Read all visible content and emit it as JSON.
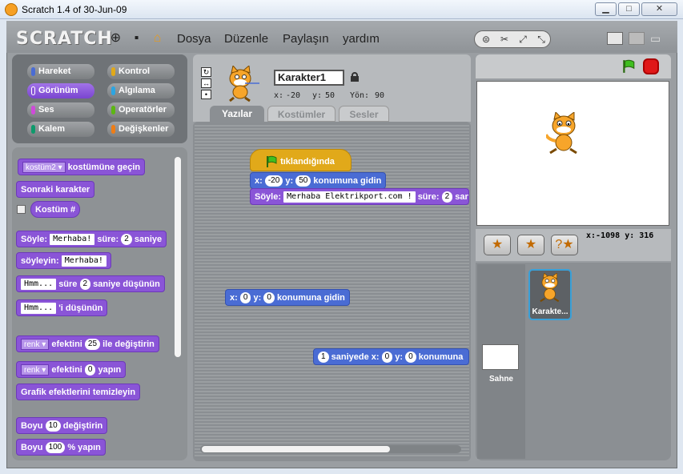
{
  "window": {
    "title": "Scratch 1.4 of 30-Jun-09",
    "minimize": "▁",
    "maximize": "□",
    "close": "✕"
  },
  "menubar": {
    "logo": "SCRATCH",
    "menus": [
      "Dosya",
      "Düzenle",
      "Paylaşın",
      "yardım"
    ]
  },
  "categories": [
    {
      "label": "Hareket",
      "color": "#4a6cd4"
    },
    {
      "label": "Kontrol",
      "color": "#e1a91a"
    },
    {
      "label": "Görünüm",
      "color": "#8a55d7",
      "selected": true
    },
    {
      "label": "Algılama",
      "color": "#2ca5e2"
    },
    {
      "label": "Ses",
      "color": "#cf4ad9"
    },
    {
      "label": "Operatörler",
      "color": "#5cb712"
    },
    {
      "label": "Kalem",
      "color": "#0e9a6c"
    },
    {
      "label": "Değişkenler",
      "color": "#ee7d16"
    }
  ],
  "palette": {
    "switch_costume": {
      "dropdown": "kostüm2",
      "text": "kostümüne geçin"
    },
    "next_costume": "Sonraki karakter",
    "costume_num": "Kostüm #",
    "say_for": {
      "pre": "Söyle:",
      "arg": "Merhaba!",
      "mid": "süre:",
      "num": "2",
      "post": "saniye"
    },
    "say": {
      "pre": "söyleyin:",
      "arg": "Merhaba!"
    },
    "think_for": {
      "arg": "Hmm...",
      "mid": "süre",
      "num": "2",
      "post": "saniye düşünün"
    },
    "think": {
      "arg": "Hmm...",
      "post": "'i düşünün"
    },
    "change_effect": {
      "dropdown": "renk",
      "mid": "efektini",
      "num": "25",
      "post": "ile değiştirin"
    },
    "set_effect": {
      "dropdown": "renk",
      "mid": "efektini",
      "num": "0",
      "post": "yapın"
    },
    "clear_effects": "Grafik efektlerini temizleyin",
    "change_size": {
      "pre": "Boyu",
      "num": "10",
      "post": "değiştirin"
    },
    "set_size": {
      "pre": "Boyu",
      "num": "100",
      "post": "% yapın"
    }
  },
  "sprite": {
    "name": "Karakter1",
    "x_label": "x:",
    "x": "-20",
    "y_label": "y:",
    "y": "50",
    "dir_label": "Yön:",
    "dir": "90"
  },
  "tabs": [
    "Yazılar",
    "Kostümler",
    "Sesler"
  ],
  "scripts": {
    "hat": "tıklandığında",
    "goto1": {
      "x_label": "x:",
      "x": "-20",
      "y_label": "y:",
      "y": "50",
      "post": "konumuna gidin"
    },
    "say1": {
      "pre": "Söyle:",
      "arg": "Merhaba Elektrikport.com !",
      "mid": "süre:",
      "num": "2",
      "post": "saniye"
    },
    "goto2": {
      "x_label": "x:",
      "x": "0",
      "y_label": "y:",
      "y": "0",
      "post": "konumuna gidin"
    },
    "glide": {
      "num": "1",
      "mid": "saniyede x:",
      "x": "0",
      "y_label": "y:",
      "y": "0",
      "post": "konumuna"
    }
  },
  "stage": {
    "mouse_x_label": "x:",
    "mouse_x": "-1098",
    "mouse_y_label": "y:",
    "mouse_y": "316"
  },
  "spritelist": {
    "stage_label": "Sahne",
    "sprite_label": "Karakte..."
  }
}
